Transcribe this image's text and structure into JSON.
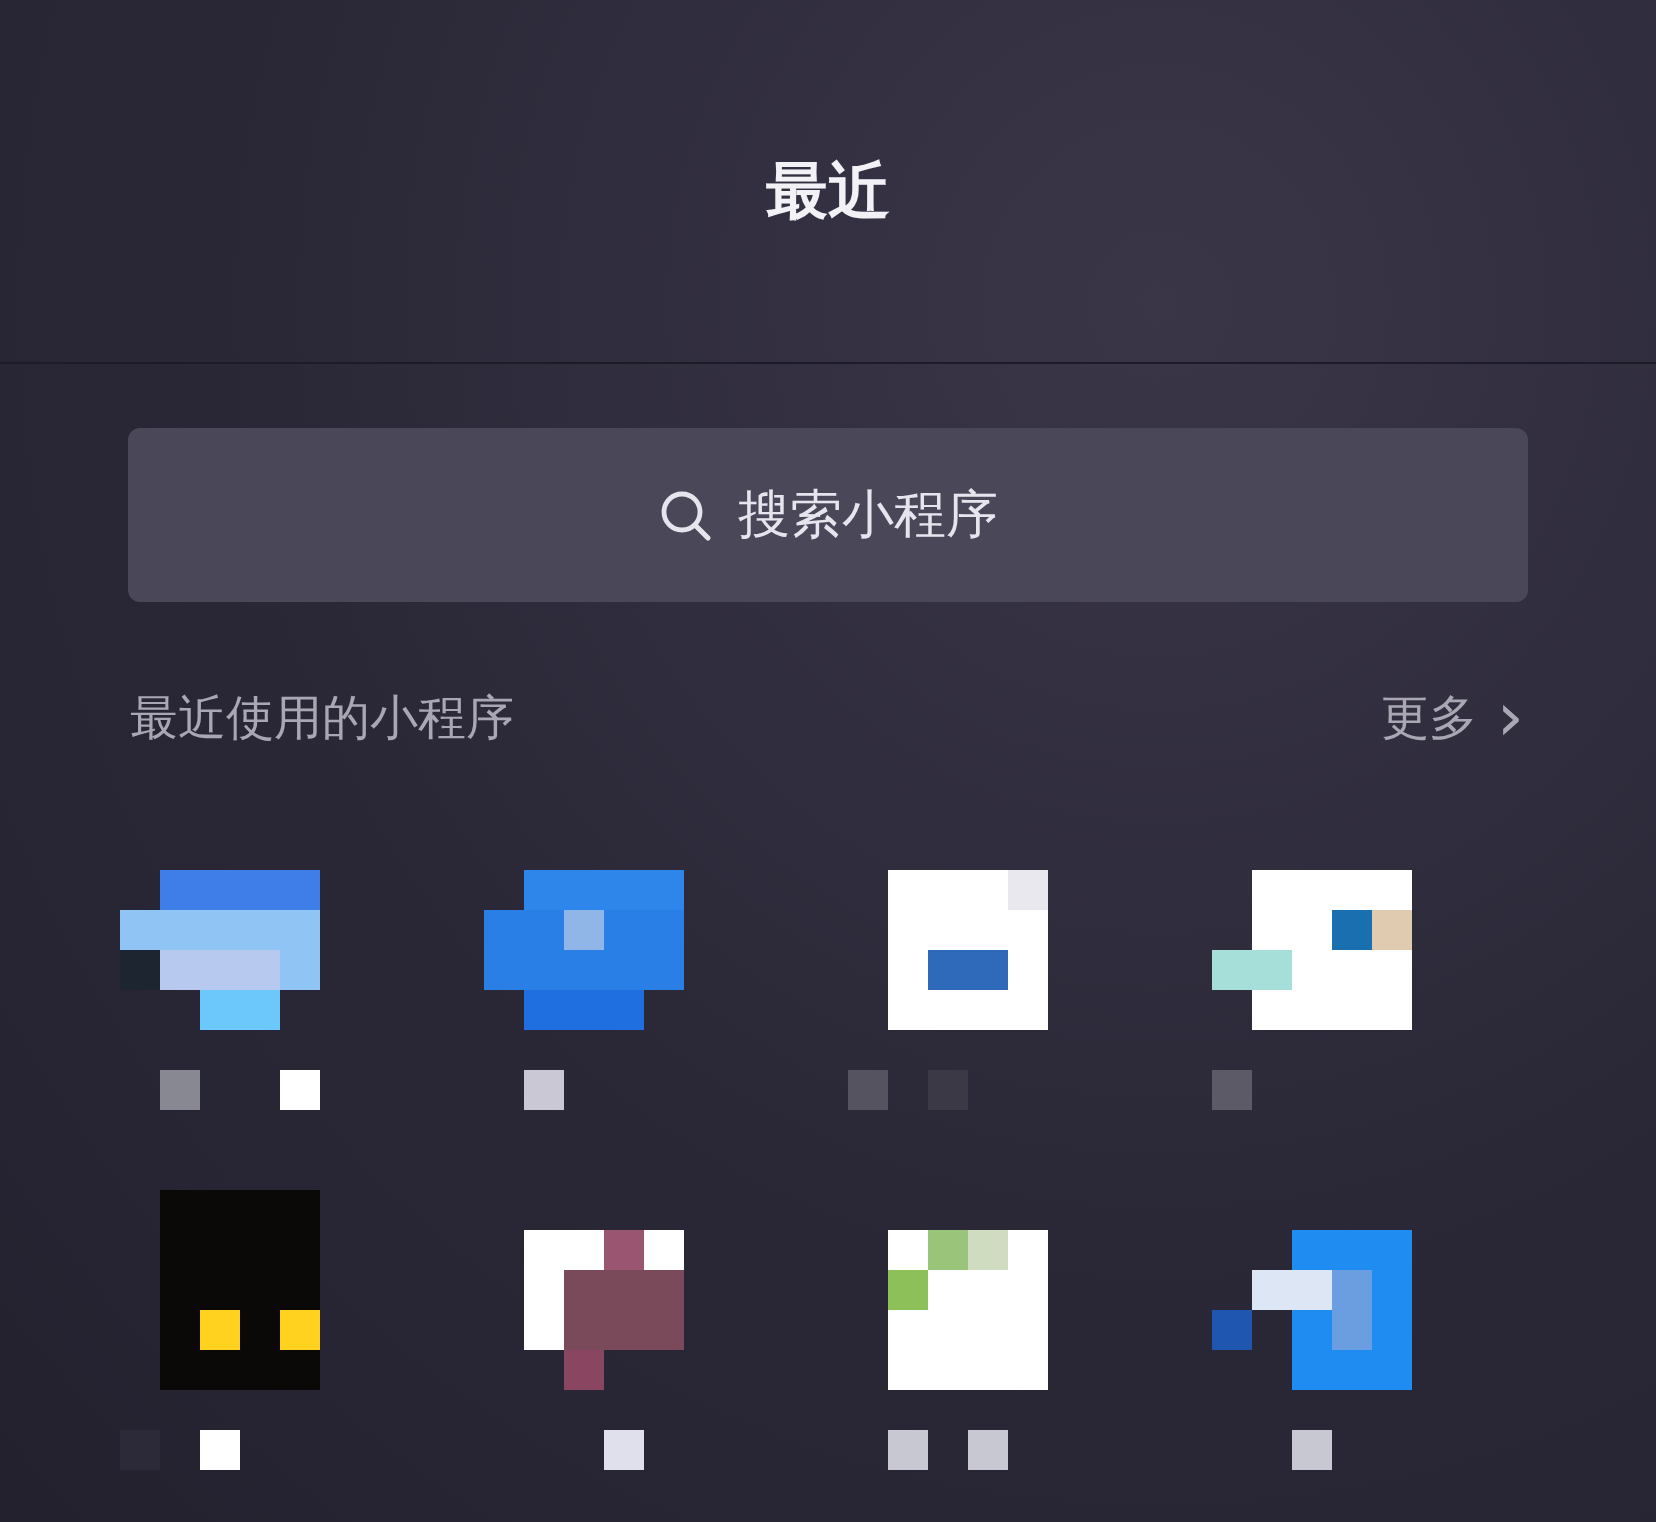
{
  "header": {
    "title": "最近"
  },
  "search": {
    "placeholder": "搜索小程序"
  },
  "section": {
    "title": "最近使用的小程序",
    "more": "更多",
    "more_icon": "›"
  }
}
